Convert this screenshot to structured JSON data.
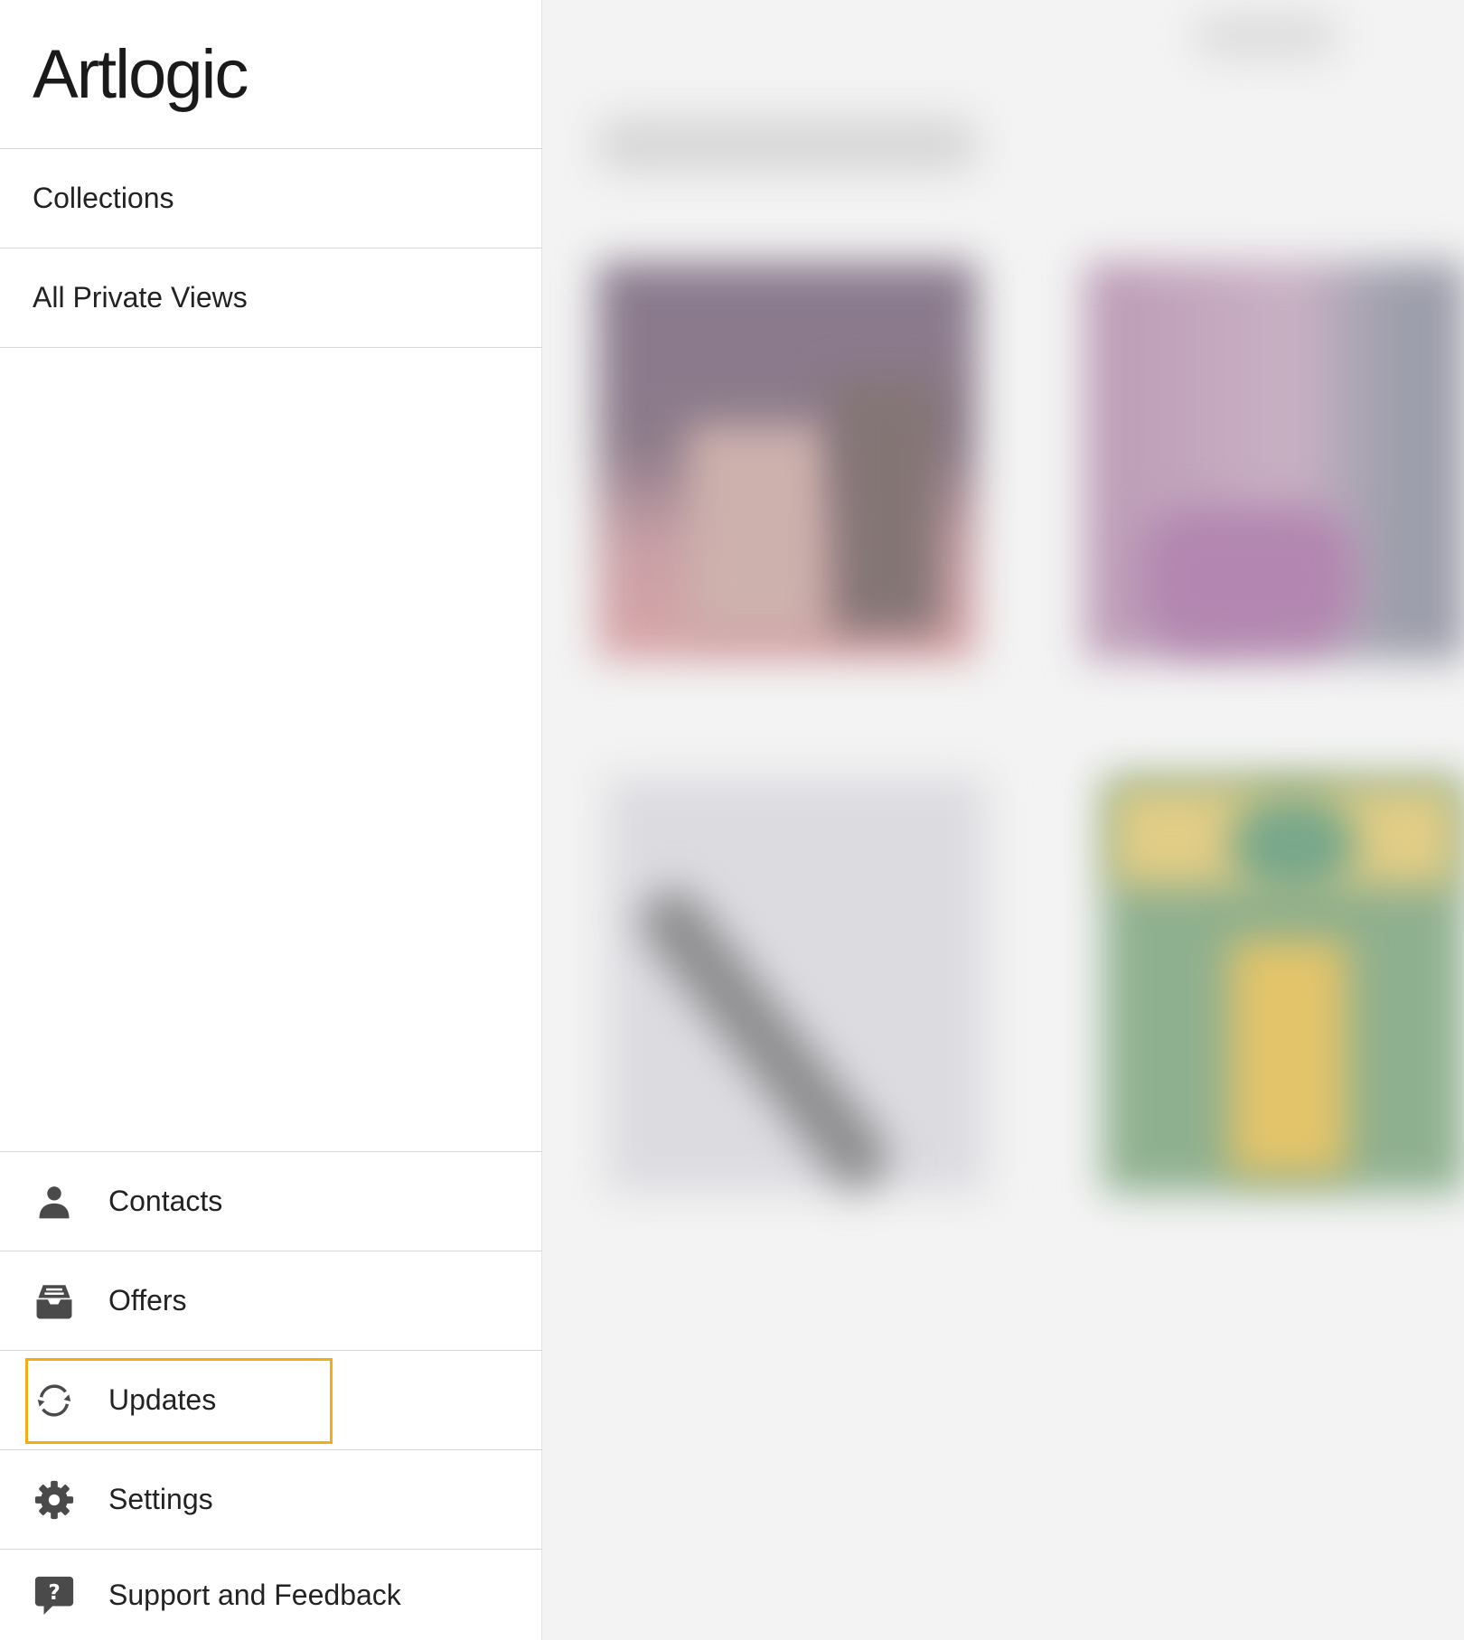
{
  "app": {
    "logo_text": "Artlogic"
  },
  "sidebar": {
    "top_items": [
      {
        "label": "Collections"
      },
      {
        "label": "All Private Views"
      }
    ],
    "bottom_items": [
      {
        "label": "Contacts",
        "icon": "person-icon"
      },
      {
        "label": "Offers",
        "icon": "inbox-tray-icon"
      },
      {
        "label": "Updates",
        "icon": "sync-icon",
        "highlighted": true
      },
      {
        "label": "Settings",
        "icon": "gear-icon"
      },
      {
        "label": "Support and Feedback",
        "icon": "help-chat-icon"
      }
    ]
  },
  "colors": {
    "highlight": "#f5ab14",
    "icon": "#4a4a4a",
    "divider": "#d6d6d6"
  }
}
